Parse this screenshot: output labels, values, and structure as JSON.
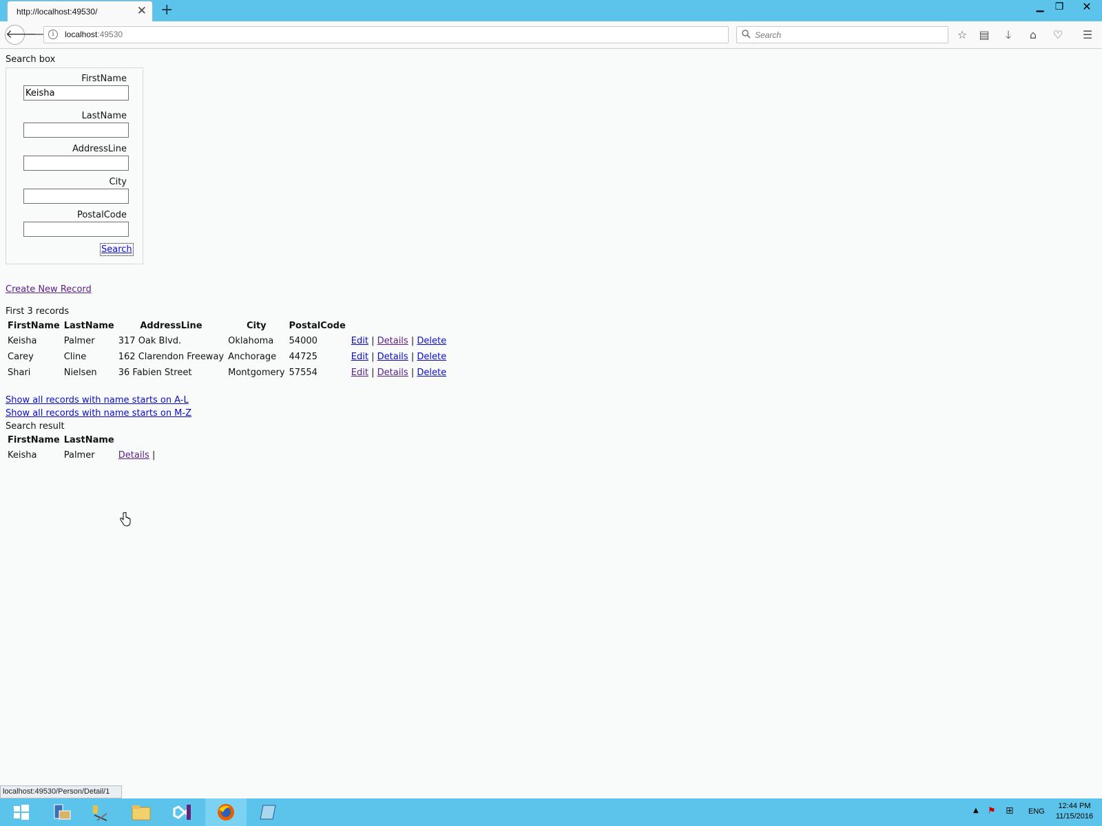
{
  "browser": {
    "tab_title": "http://localhost:49530/",
    "url_host": "localhost",
    "url_port": ":49530",
    "search_placeholder": "Search"
  },
  "search_box": {
    "legend": "Search box",
    "fields": [
      {
        "label": "FirstName",
        "value": "Keisha"
      },
      {
        "label": "LastName",
        "value": ""
      },
      {
        "label": "AddressLine",
        "value": ""
      },
      {
        "label": "City",
        "value": ""
      },
      {
        "label": "PostalCode",
        "value": ""
      }
    ],
    "submit_label": "Search"
  },
  "create_link": "Create New Record",
  "records": {
    "caption": "First 3 records",
    "headers": [
      "FirstName",
      "LastName",
      "AddressLine",
      "City",
      "PostalCode"
    ],
    "rows": [
      {
        "first": "Keisha",
        "last": "Palmer",
        "address": "317 Oak Blvd.",
        "city": "Oklahoma",
        "postal": "54000"
      },
      {
        "first": "Carey",
        "last": "Cline",
        "address": "162 Clarendon Freeway",
        "city": "Anchorage",
        "postal": "44725"
      },
      {
        "first": "Shari",
        "last": "Nielsen",
        "address": "36 Fabien Street",
        "city": "Montgomery",
        "postal": "57554"
      }
    ],
    "actions": {
      "edit": "Edit",
      "details": "Details",
      "delete": "Delete",
      "separator": "|"
    }
  },
  "filter_links": {
    "a_l": "Show all records with name starts on A-L",
    "m_z": "Show all records with name starts on M-Z"
  },
  "search_result": {
    "caption": "Search result",
    "headers": [
      "FirstName",
      "LastName"
    ],
    "rows": [
      {
        "first": "Keisha",
        "last": "Palmer",
        "details": "Details",
        "separator": "|"
      }
    ]
  },
  "status_bar": "localhost:49530/Person/Detail/1",
  "taskbar": {
    "language": "ENG",
    "time": "12:44 PM",
    "date": "11/15/2016"
  }
}
